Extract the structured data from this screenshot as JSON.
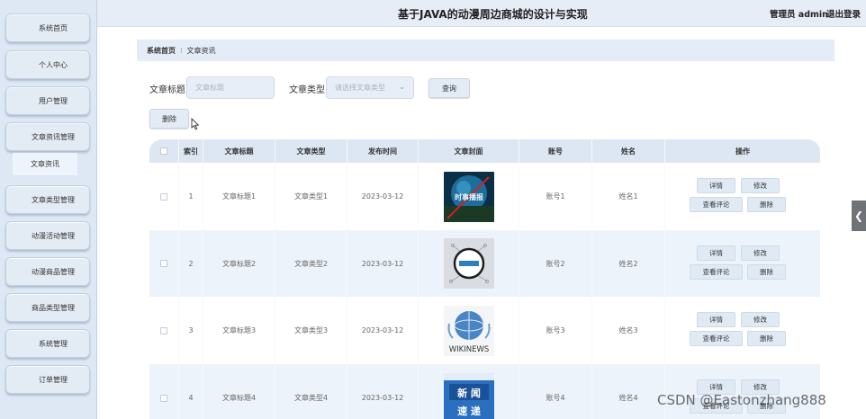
{
  "header": {
    "title": "基于JAVA的动漫周边商城的设计与实现",
    "user": "管理员 admin",
    "logout": "退出登录"
  },
  "sidebar": {
    "items": [
      {
        "label": "系统首页"
      },
      {
        "label": "个人中心"
      },
      {
        "label": "用户管理"
      },
      {
        "label": "文章资讯管理"
      },
      {
        "label": "文章类型管理"
      },
      {
        "label": "动漫活动管理"
      },
      {
        "label": "动漫商品管理"
      },
      {
        "label": "商品类型管理"
      },
      {
        "label": "系统管理"
      },
      {
        "label": "订单管理"
      }
    ],
    "sub_item": "文章资讯"
  },
  "breadcrumb": {
    "home": "系统首页",
    "separator": "⁝",
    "current": "文章资讯"
  },
  "search": {
    "title_label": "文章标题",
    "title_placeholder": "文章标题",
    "type_label": "文章类型",
    "type_placeholder": "请选择文章类型",
    "query_button": "查询",
    "delete_button": "删除"
  },
  "table": {
    "columns": [
      "索引",
      "文章标题",
      "文章类型",
      "发布时间",
      "文章封面",
      "账号",
      "姓名",
      "操作"
    ],
    "rows": [
      {
        "index": "1",
        "title": "文章标题1",
        "type": "文章类型1",
        "date": "2023-03-12",
        "account": "账号1",
        "name": "姓名1"
      },
      {
        "index": "2",
        "title": "文章标题2",
        "type": "文章类型2",
        "date": "2023-03-12",
        "account": "账号2",
        "name": "姓名2"
      },
      {
        "index": "3",
        "title": "文章标题3",
        "type": "文章类型3",
        "date": "2023-03-12",
        "account": "账号3",
        "name": "姓名3"
      },
      {
        "index": "4",
        "title": "文章标题4",
        "type": "文章类型4",
        "date": "2023-03-12",
        "account": "账号4",
        "name": "姓名4"
      }
    ],
    "actions": {
      "detail": "详情",
      "edit": "修改",
      "comments": "查看评论",
      "delete": "删除"
    }
  },
  "covers": {
    "cover1_text": "时事播报",
    "cover3_text": "WIKINEWS",
    "cover4_line1": "新 闻",
    "cover4_line2": "速 递"
  },
  "float_tab": "❮",
  "watermark": "CSDN @Eastonzhang888",
  "colors": {
    "sidebar_bg": "#dde8f4",
    "header_bg": "#e6edf6",
    "table_header": "#dce7f3"
  }
}
